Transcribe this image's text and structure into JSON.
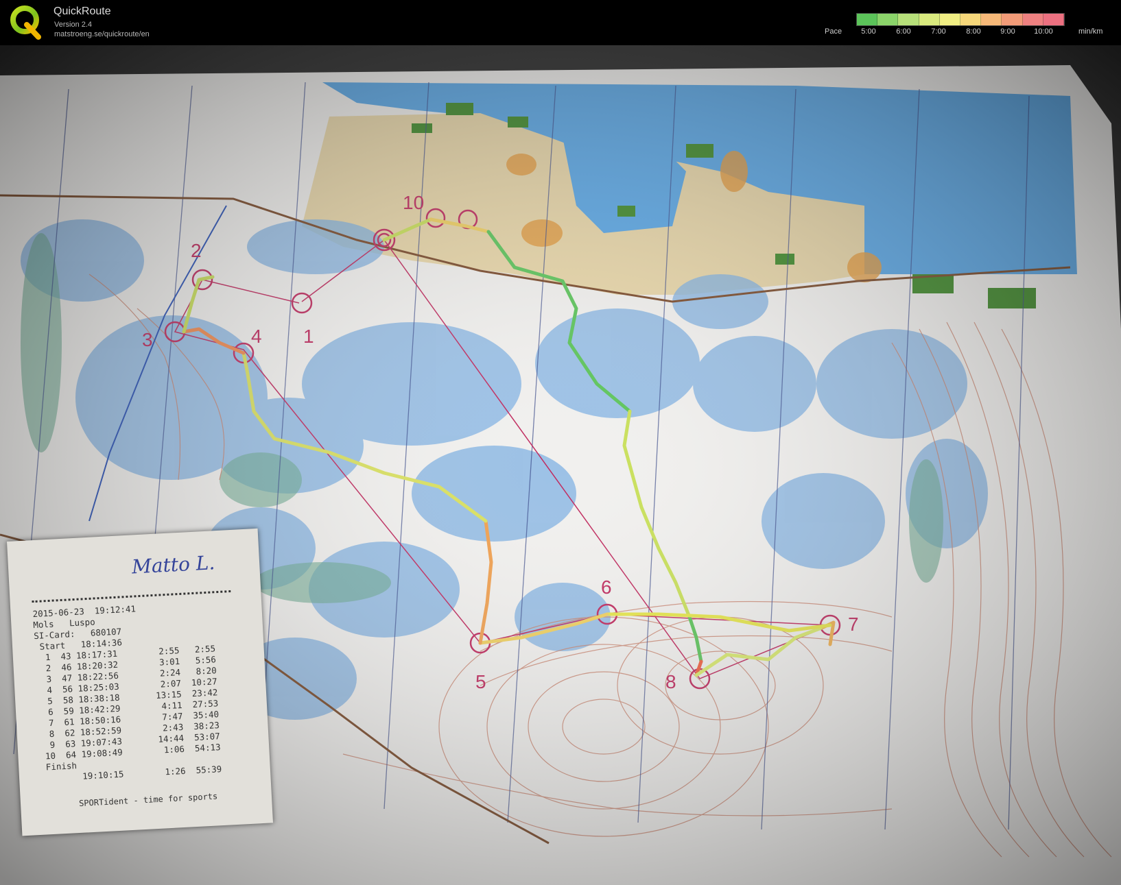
{
  "header": {
    "app_name": "QuickRoute",
    "version": "Version 2.4",
    "url": "matstroeng.se/quickroute/en"
  },
  "pace_legend": {
    "label": "Pace",
    "ticks": [
      "5:00",
      "6:00",
      "7:00",
      "8:00",
      "9:00",
      "10:00"
    ],
    "unit": "min/km",
    "gradient": [
      "#5cc45a",
      "#8bd46a",
      "#b7e07a",
      "#d9ea7e",
      "#f0ee83",
      "#f6d77a",
      "#f6b878",
      "#f29b78",
      "#ee8080",
      "#ec7080"
    ]
  },
  "map": {
    "controls": [
      "1",
      "2",
      "3",
      "4",
      "5",
      "6",
      "7",
      "8",
      "10"
    ],
    "route_colors": {
      "fast": "#3cb44b",
      "medium": "#e6e64a",
      "slow": "#f06040"
    },
    "course_color": "#c02a5e"
  },
  "receipt": {
    "signature": "Matto L.",
    "lines": [
      "2015-06-23  19:12:41",
      "Mols   Luspo",
      "SI-Card:   680107",
      " Start   18:14:36",
      "  1  43 18:17:31        2:55   2:55",
      "  2  46 18:20:32        3:01   5:56",
      "  3  47 18:22:56        2:24   8:20",
      "  4  56 18:25:03        2:07  10:27",
      "  5  58 18:38:18       13:15  23:42",
      "  6  59 18:42:29        4:11  27:53",
      "  7  61 18:50:16        7:47  35:40",
      "  8  62 18:52:59        2:43  38:23",
      "  9  63 19:07:43       14:44  53:07",
      " 10  64 19:08:49        1:06  54:13",
      " Finish",
      "        19:10:15        1:26  55:39"
    ],
    "footer": "SPORTident - time for sports"
  }
}
